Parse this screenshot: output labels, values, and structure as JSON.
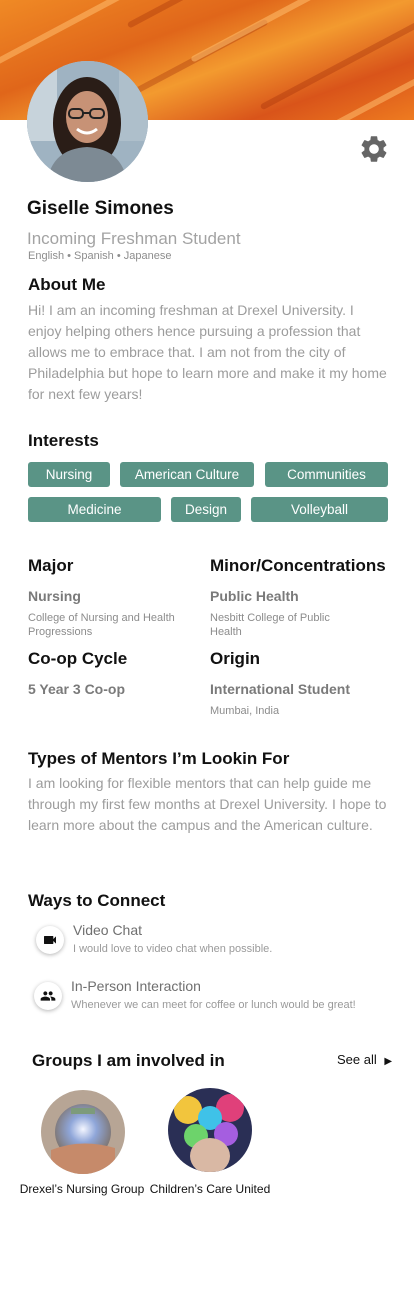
{
  "profile": {
    "name": "Giselle Simones",
    "subtitle": "Incoming Freshman Student",
    "languages": "English • Spanish • Japanese"
  },
  "about": {
    "title": "About Me",
    "text": "Hi! I am an incoming freshman at Drexel University. I enjoy helping others hence pursuing a profession that allows me to embrace that. I am not from the city of Philadelphia but hope to learn more and make it my home for next few years!"
  },
  "interests": {
    "title": "Interests",
    "tags": [
      "Nursing",
      "American Culture",
      "Communities",
      "Medicine",
      "Design",
      "Volleyball"
    ]
  },
  "details": {
    "major": {
      "title": "Major",
      "value": "Nursing",
      "sub": "College of Nursing and Health Progressions"
    },
    "minor": {
      "title": "Minor/Concentrations",
      "value": "Public Health",
      "sub": "Nesbitt College of Public Health"
    },
    "coop": {
      "title": "Co-op Cycle",
      "value": "5 Year 3 Co-op"
    },
    "origin": {
      "title": "Origin",
      "value": "International Student",
      "sub": "Mumbai, India"
    }
  },
  "mentors": {
    "title": "Types of Mentors I’m Lookin For",
    "text": "I am looking for flexible mentors that can help guide me through my first few months at Drexel University. I hope to learn more about the campus and the American culture."
  },
  "connect": {
    "title": "Ways to Connect",
    "items": [
      {
        "icon": "video-camera-icon",
        "title": "Video Chat",
        "desc": "I would love to video chat when possible."
      },
      {
        "icon": "people-icon",
        "title": "In-Person Interaction",
        "desc": "Whenever we can meet for coffee or lunch would be great!"
      }
    ]
  },
  "groups": {
    "title": "Groups I am involved in",
    "see_all": "See all",
    "items": [
      {
        "name": "Drexel’s Nursing Group"
      },
      {
        "name": "Children’s Care United"
      }
    ]
  },
  "colors": {
    "chip": "#5a9486",
    "banner": "#e8701e",
    "muted_text": "#9c9c9c"
  }
}
